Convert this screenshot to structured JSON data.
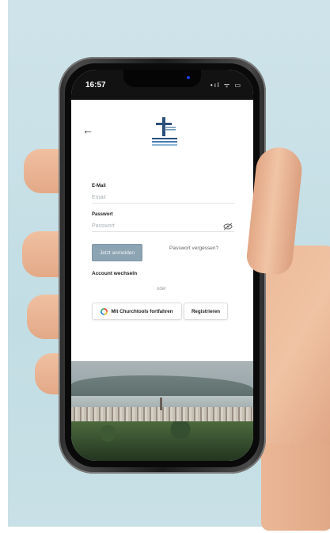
{
  "status": {
    "time": "16:57",
    "icons": "•ıl ᯤ ▭"
  },
  "login": {
    "email_label": "E-Mail",
    "email_placeholder": "Email",
    "password_label": "Passwort",
    "password_placeholder": "Passwort",
    "login_button": "Jetzt anmelden",
    "forgot_link": "Passwort vergessen?",
    "switch_account": "Account wechseln",
    "or_text": "oder",
    "churchtools_button": "Mit Churchtools fortfahren",
    "register_button": "Registrieren"
  },
  "icons": {
    "back": "back-arrow-icon",
    "eye": "eye-slash-icon",
    "logo": "cross-logo",
    "churchtools": "churchtools-icon"
  },
  "colors": {
    "login_button": "#8da4b3",
    "background": "#c2dde4"
  }
}
